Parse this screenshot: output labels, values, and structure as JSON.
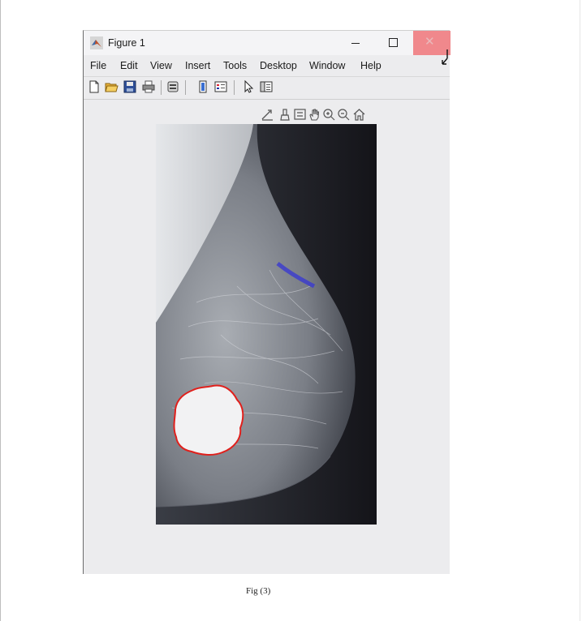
{
  "window": {
    "title": "Figure 1",
    "minimize_icon": "minimize-icon",
    "maximize_icon": "maximize-icon",
    "close_icon": "close-icon",
    "close_glyph": "✕"
  },
  "menu": {
    "items": [
      "File",
      "Edit",
      "View",
      "Insert",
      "Tools",
      "Desktop",
      "Window",
      "Help"
    ]
  },
  "toolbar": {
    "icons": [
      "new-figure-icon",
      "open-file-icon",
      "save-icon",
      "print-icon",
      "print-preview-icon",
      "colorbar-icon",
      "legend-icon",
      "edit-plot-icon",
      "property-inspector-icon"
    ]
  },
  "axes_toolbar": {
    "icons": [
      "export-icon",
      "brush-icon",
      "data-tips-icon",
      "pan-icon",
      "zoom-in-icon",
      "zoom-out-icon",
      "home-icon"
    ]
  },
  "image": {
    "subject": "mammogram",
    "outline_color": "#e0201c",
    "highlight_color": "#3a3ad0"
  },
  "caption": "Fig (3)"
}
